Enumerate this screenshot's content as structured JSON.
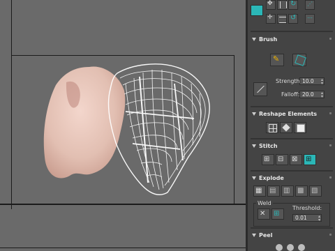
{
  "sections": {
    "brush": {
      "title": "Brush",
      "strength_label": "Strength:",
      "strength_value": "10.0",
      "falloff_label": "Falloff:",
      "falloff_value": "20.0"
    },
    "reshape": {
      "title": "Reshape Elements"
    },
    "stitch": {
      "title": "Stitch"
    },
    "explode": {
      "title": "Explode",
      "weld_label": "Weld",
      "threshold_label": "Threshold:",
      "threshold_value": "0.01"
    },
    "peel": {
      "title": "Peel"
    }
  },
  "colors": {
    "accent": "#2bb7b7",
    "panel_bg": "#444444",
    "viewport_bg": "#6a6a6a"
  },
  "icons": [
    "brush-paint-icon",
    "brush-cube-icon",
    "line-tool-icon",
    "reshape-grid-icon",
    "reshape-box-icon",
    "reshape-cube-icon",
    "stitch-target-icon",
    "stitch-source-icon",
    "stitch-average-icon",
    "stitch-custom-icon",
    "explode-icon",
    "weld-selected-icon",
    "weld-all-icon"
  ]
}
